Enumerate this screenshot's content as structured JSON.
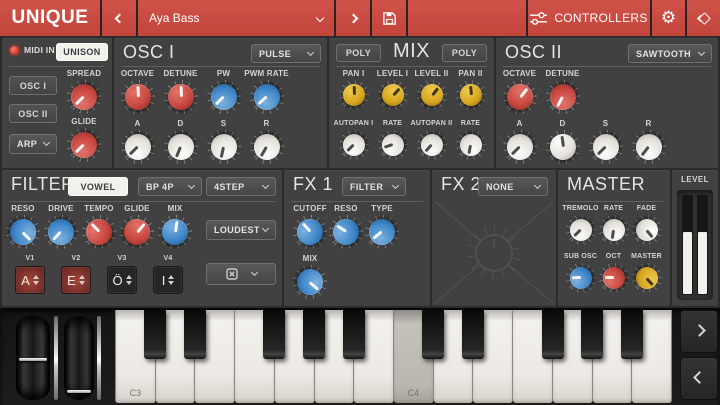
{
  "colors": {
    "accent_red": "#cb4a42",
    "knob_red": "#c6463e",
    "knob_blue": "#3d85c8",
    "knob_yellow": "#d5a51e",
    "knob_cream": "#e9e6e0",
    "panel_bg": "#414141"
  },
  "titlebar": {
    "logo": "UNIQUE",
    "preset": "Aya Bass",
    "controllers": "CONTROLLERS"
  },
  "sidebar": {
    "midi_in": "MIDI IN",
    "unison": "UNISON",
    "osc1": "OSC I",
    "osc2": "OSC II",
    "arp": "ARP",
    "spread": {
      "label": "SPREAD",
      "angle": -135
    },
    "glide": {
      "label": "GLIDE",
      "angle": -135
    }
  },
  "osc1": {
    "title": "OSC I",
    "wave": "PULSE",
    "knobs": [
      {
        "label": "OCTAVE",
        "angle": -3
      },
      {
        "label": "DETUNE",
        "angle": -2
      },
      {
        "label": "PW",
        "angle": -135
      },
      {
        "label": "PWM RATE",
        "angle": -132
      }
    ],
    "env": [
      {
        "label": "A",
        "angle": -135
      },
      {
        "label": "D",
        "angle": -158
      },
      {
        "label": "S",
        "angle": -168
      },
      {
        "label": "R",
        "angle": -150
      }
    ]
  },
  "mix": {
    "title": "MIX",
    "poly_left": "POLY",
    "poly_right": "POLY",
    "row1": [
      {
        "label": "PAN I",
        "angle": -2
      },
      {
        "label": "LEVEL I",
        "angle": 42
      },
      {
        "label": "LEVEL II",
        "angle": 38
      },
      {
        "label": "PAN II",
        "angle": -6
      }
    ],
    "row2": [
      {
        "label": "AUTOPAN I",
        "angle": -135
      },
      {
        "label": "RATE",
        "angle": -108
      },
      {
        "label": "AUTOPAN II",
        "angle": -138
      },
      {
        "label": "RATE",
        "angle": -170
      }
    ]
  },
  "osc2": {
    "title": "OSC II",
    "wave": "SAWTOOTH",
    "knobs": [
      {
        "label": "OCTAVE",
        "angle": 38
      },
      {
        "label": "DETUNE",
        "angle": -152
      }
    ],
    "env": [
      {
        "label": "A",
        "angle": -135
      },
      {
        "label": "D",
        "angle": -8
      },
      {
        "label": "S",
        "angle": -135
      },
      {
        "label": "R",
        "angle": -142
      }
    ]
  },
  "filter": {
    "title": "FILTER",
    "mode": "VOWEL",
    "type": "BP 4P",
    "seq": "4STEP",
    "order": "LOUDEST",
    "knobs": [
      {
        "label": "RESO",
        "angle": 135
      },
      {
        "label": "DRIVE",
        "angle": -138
      },
      {
        "label": "TEMPO",
        "angle": -45
      },
      {
        "label": "GLIDE",
        "angle": 40
      },
      {
        "label": "MIX",
        "angle": 8
      }
    ],
    "v_labels": [
      "V1",
      "V2",
      "V3",
      "V4"
    ],
    "vowels": [
      {
        "label": "A",
        "active": true
      },
      {
        "label": "E",
        "active": true
      },
      {
        "label": "Ö",
        "active": false
      },
      {
        "label": "I",
        "active": false
      }
    ]
  },
  "fx1": {
    "title": "FX 1",
    "type": "FILTER",
    "knobs": [
      {
        "label": "CUTOFF",
        "angle": -42
      },
      {
        "label": "RESO",
        "angle": -58
      },
      {
        "label": "TYPE",
        "angle": -130
      }
    ],
    "mix": {
      "label": "MIX",
      "angle": 130
    }
  },
  "fx2": {
    "title": "FX 2",
    "type": "NONE"
  },
  "master": {
    "title": "MASTER",
    "row1": [
      {
        "label": "TREMOLO",
        "angle": -135
      },
      {
        "label": "RATE",
        "angle": -172
      },
      {
        "label": "FADE",
        "angle": 140
      }
    ],
    "row2": [
      {
        "label": "SUB OSC",
        "angle": -92
      },
      {
        "label": "OCT",
        "angle": -90
      },
      {
        "label": "MASTER",
        "angle": 138
      }
    ]
  },
  "level": {
    "label": "LEVEL",
    "value_pct": 62
  },
  "keyboard": {
    "white_keys": 14,
    "black_after": [
      0,
      1,
      3,
      4,
      5
    ],
    "labels": {
      "0": "C3",
      "7": "C4"
    },
    "pressed_index": 7
  }
}
